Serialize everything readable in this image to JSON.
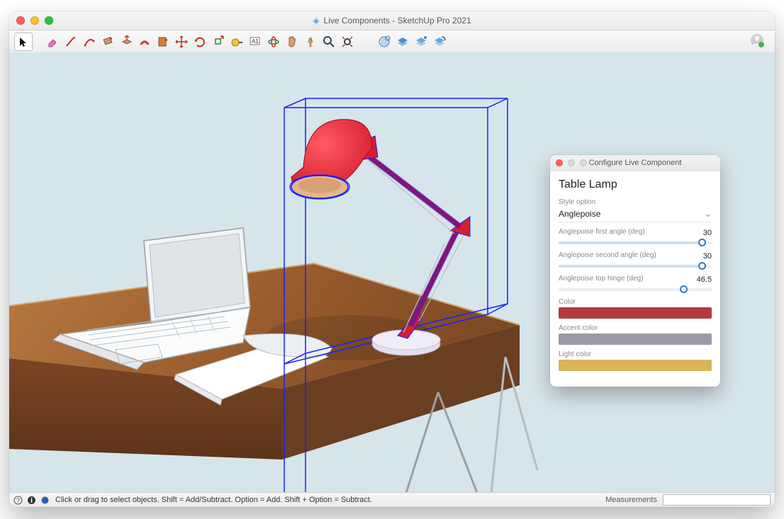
{
  "window": {
    "title": "Live Components - SketchUp Pro 2021"
  },
  "toolbar": {
    "tools": [
      "select",
      "eraser",
      "line",
      "arc",
      "rectangle",
      "push-pull",
      "offset",
      "paint",
      "move",
      "rotate",
      "scale",
      "tape-measure",
      "text",
      "orbit",
      "pan",
      "walk",
      "zoom",
      "zoom-extents"
    ],
    "extTools": [
      "warehouse",
      "ext-1",
      "ext-2",
      "ext-3"
    ]
  },
  "panel": {
    "title": "Configure Live Component",
    "heading": "Table Lamp",
    "style_option_label": "Style option",
    "style_option_value": "Anglepoise",
    "sliders": [
      {
        "label": "Anglepoise first angle (deg)",
        "value": "30",
        "pct": 94,
        "fill": "#cfe0ee"
      },
      {
        "label": "Anglepoise second angle (deg)",
        "value": "30",
        "pct": 94,
        "fill": "#cfe0ee"
      },
      {
        "label": "Anglepoise top hinge (deg)",
        "value": "46.5",
        "pct": 82,
        "fill": "#eceff1"
      }
    ],
    "colors": [
      {
        "label": "Color",
        "hex": "#b43a3f"
      },
      {
        "label": "Accent color",
        "hex": "#9a9aa6"
      },
      {
        "label": "Light color",
        "hex": "#d7b559"
      }
    ]
  },
  "status": {
    "hint": "Click or drag to select objects. Shift = Add/Subtract. Option = Add. Shift + Option = Subtract.",
    "measure_label": "Measurements"
  }
}
